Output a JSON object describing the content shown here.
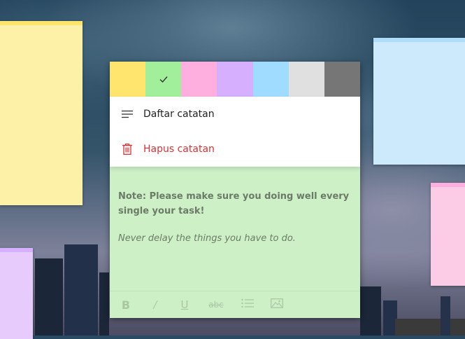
{
  "colors": {
    "yellow_note": "#fdf1a8",
    "blue_note": "#cde9fc",
    "pink_note": "#fccbe6",
    "purple_note": "#e6cbfc",
    "active_note": "#cdf0c6",
    "delete_red": "#d13438"
  },
  "palette": [
    {
      "name": "yellow",
      "color": "#ffe46e",
      "selected": false
    },
    {
      "name": "green",
      "color": "#a1ef9b",
      "selected": true
    },
    {
      "name": "pink",
      "color": "#ffafdf",
      "selected": false
    },
    {
      "name": "purple",
      "color": "#d7afff",
      "selected": false
    },
    {
      "name": "blue",
      "color": "#9fdcff",
      "selected": false
    },
    {
      "name": "gray",
      "color": "#e0e0e0",
      "selected": false
    },
    {
      "name": "charcoal",
      "color": "#767676",
      "selected": false
    }
  ],
  "menu": {
    "list_notes_label": "Daftar catatan",
    "list_notes_icon": "list-icon",
    "delete_note_label": "Hapus catatan",
    "delete_note_icon": "trash-icon"
  },
  "note": {
    "bold_text": "Note: Please make sure you doing well every single your task!",
    "italic_text": "Never delay the things you have to do."
  },
  "toolbar": {
    "bold_label": "B",
    "italic_label": "/",
    "underline_label": "U",
    "strike_label": "abc",
    "list_icon": "bullet-list-icon",
    "image_icon": "image-icon"
  }
}
